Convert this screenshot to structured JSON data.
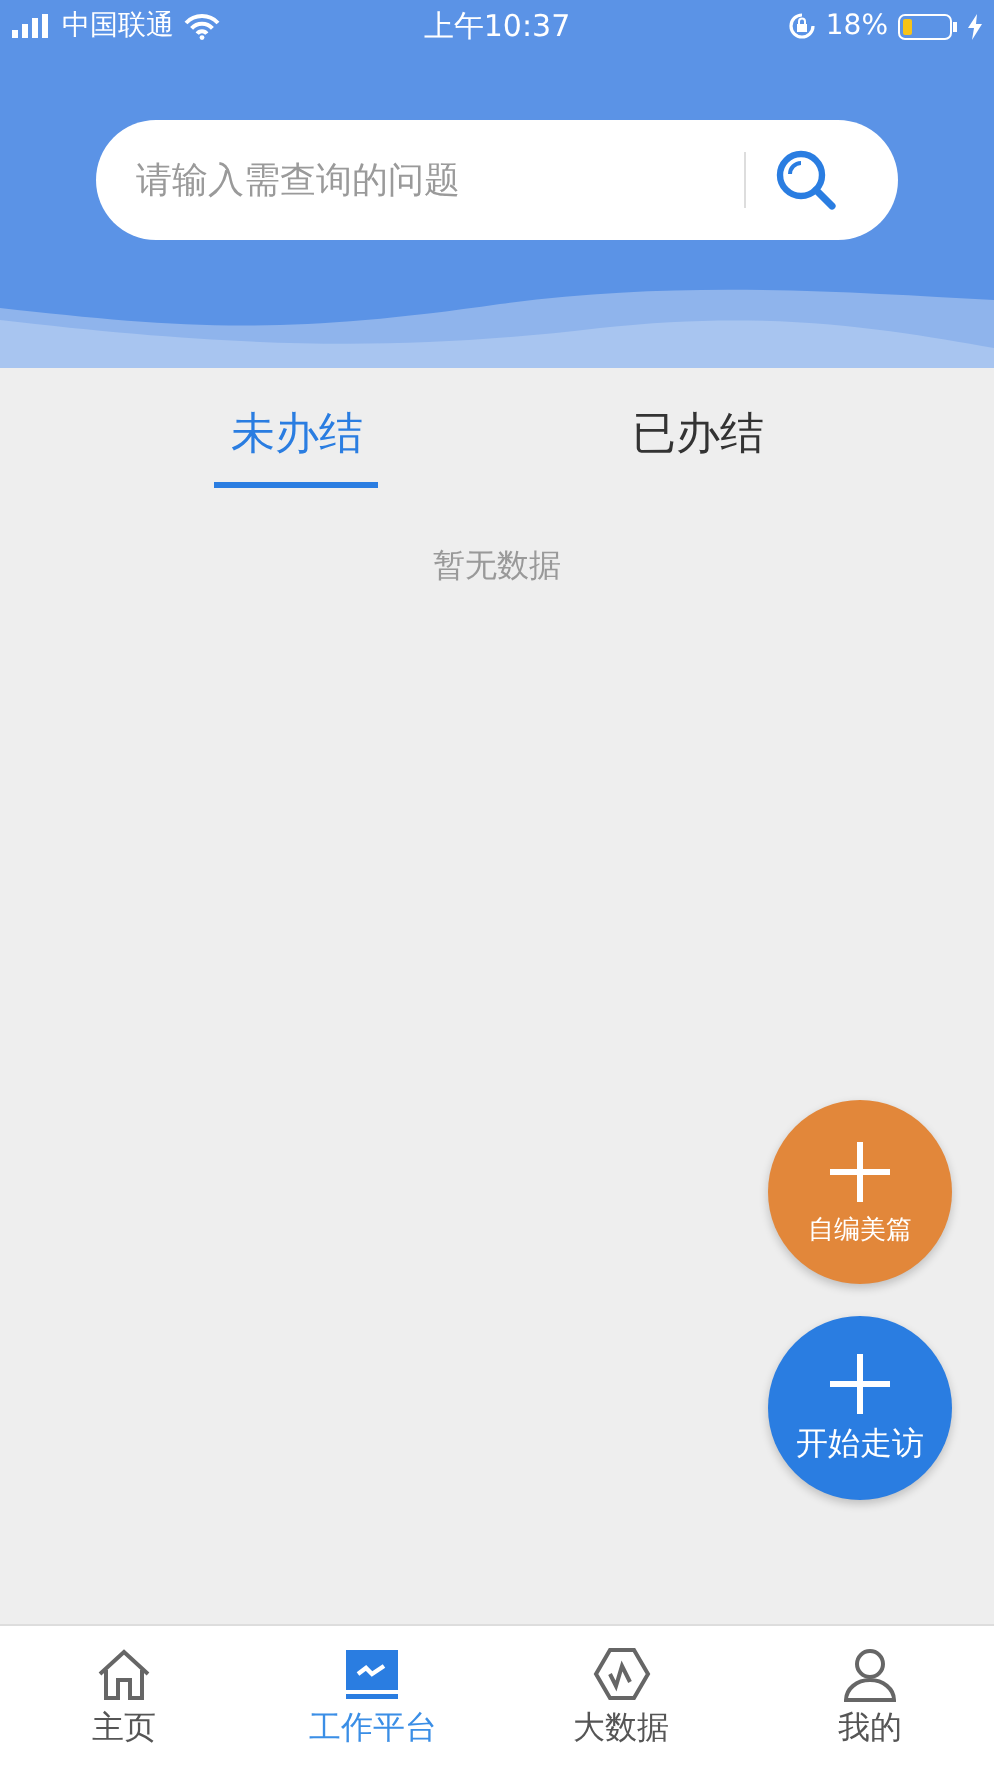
{
  "status_bar": {
    "carrier": "中国联通",
    "time": "上午10:37",
    "battery": "18%"
  },
  "search": {
    "placeholder": "请输入需查询的问题"
  },
  "tabs": [
    {
      "label": "未办结",
      "selected": true
    },
    {
      "label": "已办结",
      "selected": false
    }
  ],
  "empty_message": "暂无数据",
  "actions": [
    {
      "label": "自编美篇",
      "color": "#e2873a"
    },
    {
      "label": "开始走访",
      "color": "#2a7de1"
    }
  ],
  "tab_bar": [
    {
      "label": "主页",
      "selected": false
    },
    {
      "label": "工作平台",
      "selected": true
    },
    {
      "label": "大数据",
      "selected": false
    },
    {
      "label": "我的",
      "selected": false
    }
  ]
}
